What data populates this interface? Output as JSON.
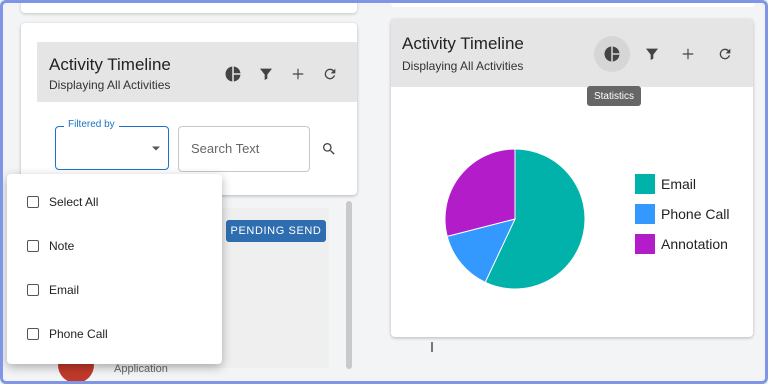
{
  "left_panel": {
    "title": "Activity Timeline",
    "subtitle": "Displaying All Activities",
    "filter_label": "Filtered by",
    "search_placeholder": "Search Text",
    "badge": "PENDING SEND",
    "app_text": "Application",
    "dropdown_options": [
      "Select All",
      "Note",
      "Email",
      "Phone Call"
    ]
  },
  "right_panel": {
    "title": "Activity Timeline",
    "subtitle": "Displaying All Activities",
    "tooltip": "Statistics"
  },
  "icons": {
    "chart": "pie-chart-icon",
    "filter": "filter-icon",
    "add": "plus-icon",
    "refresh": "refresh-icon",
    "search": "search-icon",
    "dropdown": "caret-down-icon"
  },
  "colors": {
    "email": "#00b2a9",
    "phone_call": "#3399ff",
    "annotation": "#b31dc9",
    "accent": "#1a73c8",
    "badge": "#2e6eb0"
  },
  "chart_data": {
    "type": "pie",
    "categories": [
      "Email",
      "Phone Call",
      "Annotation"
    ],
    "values": [
      57,
      14,
      29
    ],
    "legend_position": "right"
  }
}
